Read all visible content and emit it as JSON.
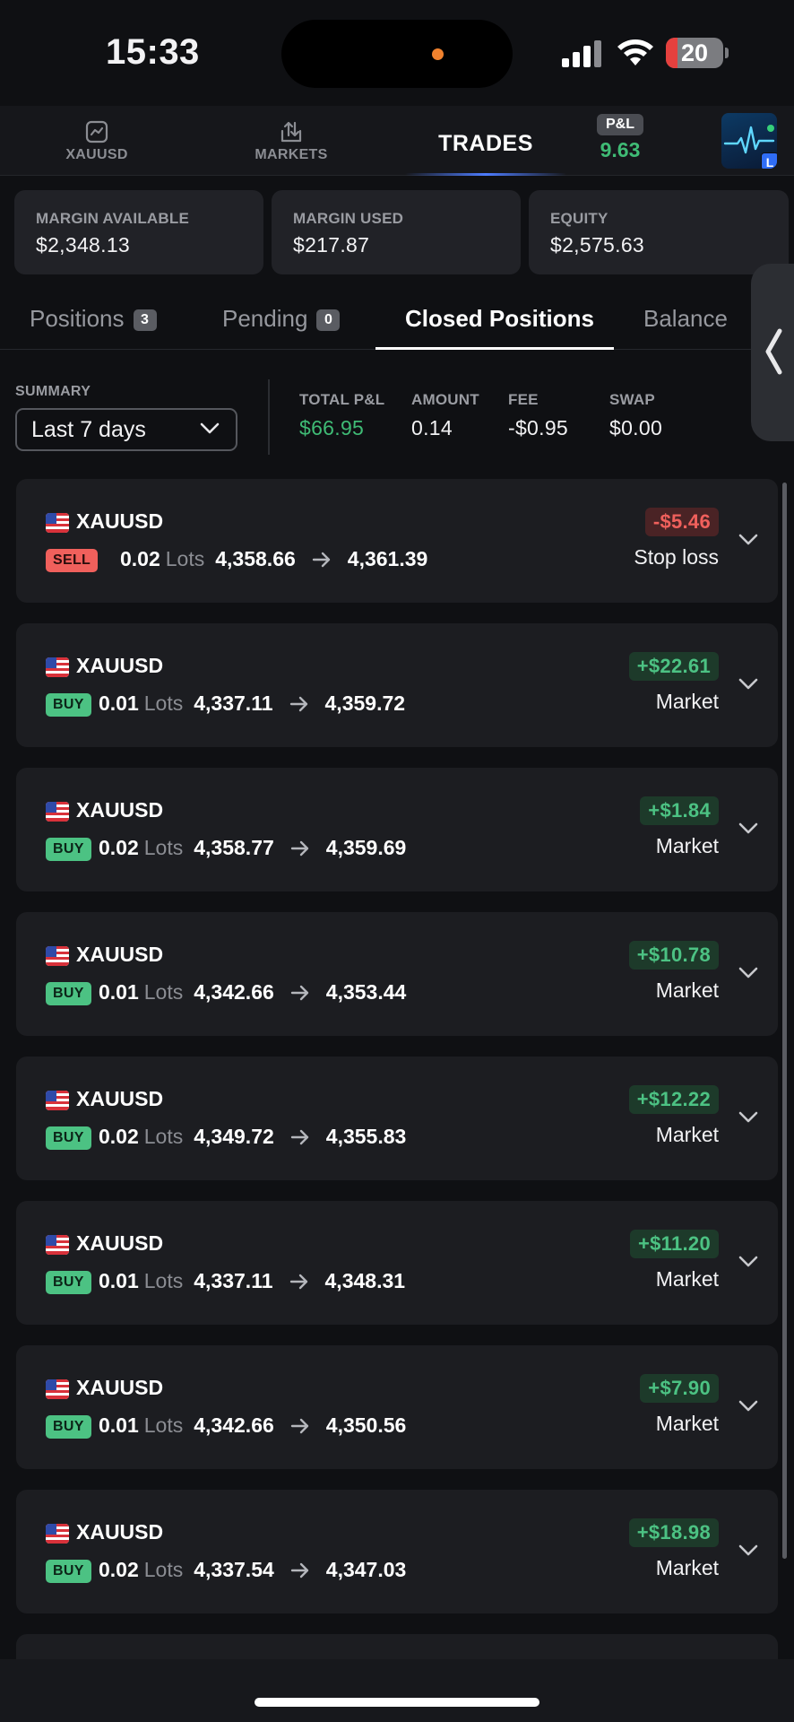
{
  "status_bar": {
    "time": "15:33",
    "battery": "20",
    "battery_level": 0.2
  },
  "top_nav": {
    "items": [
      {
        "label": "XAUUSD",
        "icon": "chart-icon"
      },
      {
        "label": "MARKETS",
        "icon": "transfer-icon"
      }
    ],
    "active": "TRADES",
    "pnl_label": "P&L",
    "pnl_value": "9.63",
    "avatar_badge": "L"
  },
  "margin": [
    {
      "label": "MARGIN AVAILABLE",
      "value": "$2,348.13"
    },
    {
      "label": "MARGIN USED",
      "value": "$217.87"
    },
    {
      "label": "EQUITY",
      "value": "$2,575.63"
    }
  ],
  "tabs": [
    {
      "label": "Positions",
      "count": "3"
    },
    {
      "label": "Pending",
      "count": "0"
    },
    {
      "label": "Closed Positions"
    },
    {
      "label": "Balance"
    }
  ],
  "summary": {
    "label": "SUMMARY",
    "range": "Last 7 days",
    "stats": [
      {
        "label": "TOTAL P&L",
        "value": "$66.95"
      },
      {
        "label": "AMOUNT",
        "value": "0.14"
      },
      {
        "label": "FEE",
        "value": "-$0.95"
      },
      {
        "label": "SWAP",
        "value": "$0.00"
      }
    ]
  },
  "colors": {
    "positive": "#4cc283",
    "negative": "#f0605c",
    "background": "#0f1013",
    "card": "#1c1d21"
  },
  "trades": [
    {
      "symbol": "XAUUSD",
      "side": "SELL",
      "lots": "0.02",
      "lots_unit": "Lots",
      "open": "4,358.66",
      "close": "4,361.39",
      "pnl": "-$5.46",
      "reason": "Stop loss"
    },
    {
      "symbol": "XAUUSD",
      "side": "BUY",
      "lots": "0.01",
      "lots_unit": "Lots",
      "open": "4,337.11",
      "close": "4,359.72",
      "pnl": "+$22.61",
      "reason": "Market"
    },
    {
      "symbol": "XAUUSD",
      "side": "BUY",
      "lots": "0.02",
      "lots_unit": "Lots",
      "open": "4,358.77",
      "close": "4,359.69",
      "pnl": "+$1.84",
      "reason": "Market"
    },
    {
      "symbol": "XAUUSD",
      "side": "BUY",
      "lots": "0.01",
      "lots_unit": "Lots",
      "open": "4,342.66",
      "close": "4,353.44",
      "pnl": "+$10.78",
      "reason": "Market"
    },
    {
      "symbol": "XAUUSD",
      "side": "BUY",
      "lots": "0.02",
      "lots_unit": "Lots",
      "open": "4,349.72",
      "close": "4,355.83",
      "pnl": "+$12.22",
      "reason": "Market"
    },
    {
      "symbol": "XAUUSD",
      "side": "BUY",
      "lots": "0.01",
      "lots_unit": "Lots",
      "open": "4,337.11",
      "close": "4,348.31",
      "pnl": "+$11.20",
      "reason": "Market"
    },
    {
      "symbol": "XAUUSD",
      "side": "BUY",
      "lots": "0.01",
      "lots_unit": "Lots",
      "open": "4,342.66",
      "close": "4,350.56",
      "pnl": "+$7.90",
      "reason": "Market"
    },
    {
      "symbol": "XAUUSD",
      "side": "BUY",
      "lots": "0.02",
      "lots_unit": "Lots",
      "open": "4,337.54",
      "close": "4,347.03",
      "pnl": "+$18.98",
      "reason": "Market"
    }
  ]
}
